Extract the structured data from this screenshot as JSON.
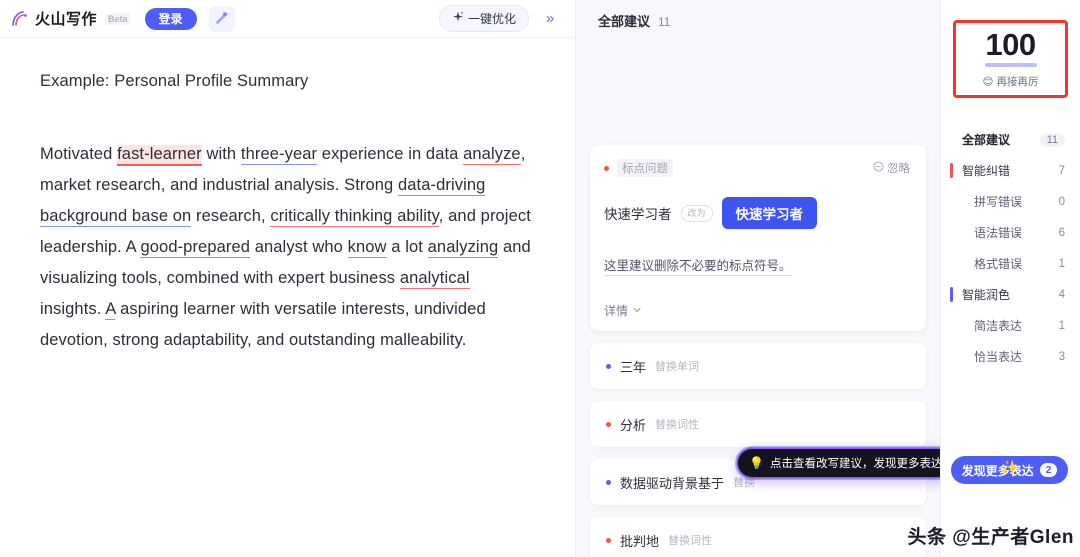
{
  "topbar": {
    "brand_name": "火山写作",
    "beta_tag": "Beta",
    "login_label": "登录",
    "magic_icon": "magic-wand-icon",
    "optimize_label": "一键优化",
    "optimize_icon": "sparkle-icon",
    "expand_icon": "double-chevron-right-icon"
  },
  "document": {
    "title": "Example: Personal Profile Summary",
    "paragraph": [
      {
        "t": "Motivated ",
        "style": "plain"
      },
      {
        "t": "fast-learner",
        "style": "u-red-hl"
      },
      {
        "t": " with ",
        "style": "plain"
      },
      {
        "t": "three-year",
        "style": "u-blue"
      },
      {
        "t": " experience in data ",
        "style": "plain"
      },
      {
        "t": "analyze",
        "style": "u-red"
      },
      {
        "t": ", market research, and industrial analysis. Strong ",
        "style": "plain"
      },
      {
        "t": "data-driving background base on",
        "style": "u-blue"
      },
      {
        "t": " research, ",
        "style": "plain"
      },
      {
        "t": "critically thinking ability",
        "style": "u-red"
      },
      {
        "t": ", and project leadership. A ",
        "style": "plain"
      },
      {
        "t": "good-prepared",
        "style": "u-blue"
      },
      {
        "t": " analyst who ",
        "style": "plain"
      },
      {
        "t": "know",
        "style": "u-red"
      },
      {
        "t": " a lot ",
        "style": "plain"
      },
      {
        "t": "analyzing",
        "style": "u-red"
      },
      {
        "t": " and visualizing tools, combined with expert business ",
        "style": "plain"
      },
      {
        "t": "analytical",
        "style": "u-red"
      },
      {
        "t": " insights. ",
        "style": "plain"
      },
      {
        "t": "A",
        "style": "u-red"
      },
      {
        "t": " aspiring learner with versatile interests, undivided devotion, strong adaptability, and outstanding malleability.",
        "style": "plain"
      }
    ]
  },
  "suggestions": {
    "header_label": "全部建议",
    "header_count": "11",
    "card": {
      "dot_color": "red",
      "type_label": "标点问题",
      "ignore_label": "忽略",
      "ignore_icon": "circle-minus-icon",
      "original": "快速学习者",
      "arrow_label": "改为",
      "replacement": "快速学习者",
      "description": "这里建议删除不必要的标点符号。",
      "detail_label": "详情",
      "detail_icon": "chevron-down-icon"
    },
    "items": [
      {
        "dot_color": "blue",
        "word": "三年",
        "tag": "替换单词"
      },
      {
        "dot_color": "red",
        "word": "分析",
        "tag": "替换词性"
      },
      {
        "dot_color": "blue",
        "word": "数据驱动背景基于",
        "tag": "替换"
      },
      {
        "dot_color": "red",
        "word": "批判地",
        "tag": "替换词性"
      }
    ]
  },
  "tooltip": {
    "icon": "lightbulb-icon",
    "text": "点击查看改写建议，发现更多表达"
  },
  "sidebar": {
    "score": "100",
    "score_sub": "再接再厉",
    "score_emoji": "😊",
    "nav": [
      {
        "label": "全部建议",
        "count": "11",
        "level": "head",
        "bar": "none",
        "pill": true
      },
      {
        "label": "智能纠错",
        "count": "7",
        "level": "group",
        "bar": "red",
        "pill": false
      },
      {
        "label": "拼写错误",
        "count": "0",
        "level": "sub",
        "bar": "none",
        "pill": false
      },
      {
        "label": "语法错误",
        "count": "6",
        "level": "sub",
        "bar": "none",
        "pill": false
      },
      {
        "label": "格式错误",
        "count": "1",
        "level": "sub",
        "bar": "none",
        "pill": false
      },
      {
        "label": "智能润色",
        "count": "4",
        "level": "group",
        "bar": "blue",
        "pill": false
      },
      {
        "label": "简洁表达",
        "count": "1",
        "level": "sub",
        "bar": "none",
        "pill": false
      },
      {
        "label": "恰当表达",
        "count": "3",
        "level": "sub",
        "bar": "none",
        "pill": false
      }
    ],
    "discover_label": "发现更多表达",
    "discover_count": "2"
  },
  "watermark": "头条 @生产者Glen",
  "colors": {
    "accent_blue": "#4e5ef5",
    "error_red": "#f0554f",
    "score_border": "#f4352e"
  }
}
